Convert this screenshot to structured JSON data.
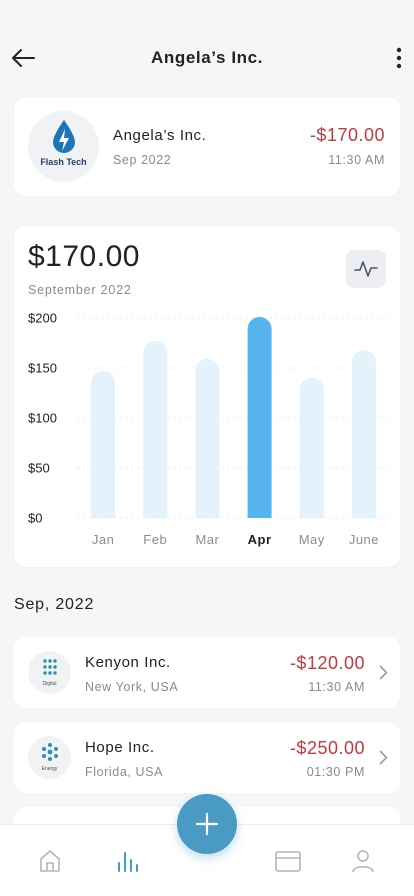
{
  "header": {
    "title": "Angela’s Inc."
  },
  "merchant": {
    "brand_text": "Flash Tech",
    "name": "Angela’s Inc.",
    "date": "Sep 2022",
    "amount": "-$170.00",
    "time": "11:30 AM"
  },
  "summary": {
    "total": "$170.00",
    "period": "September 2022"
  },
  "chart_data": {
    "type": "bar",
    "categories": [
      "Jan",
      "Feb",
      "Mar",
      "Apr",
      "May",
      "June"
    ],
    "values": [
      147,
      177,
      159,
      201,
      140,
      168
    ],
    "highlighted": "Apr",
    "yticks": [
      "$0",
      "$50",
      "$100",
      "$150",
      "$200"
    ],
    "ytick_values": [
      0,
      50,
      100,
      150,
      200
    ],
    "ylim": [
      0,
      200
    ],
    "grid": true,
    "colors": {
      "bar": "#e4f2fc",
      "active": "#56b4ef",
      "grid": "#ececf0"
    }
  },
  "section": {
    "title": "Sep, 2022"
  },
  "transactions": [
    {
      "icon": "digital-logo-icon",
      "caption": "Digital",
      "name": "Kenyon Inc.",
      "location": "New York, USA",
      "amount": "-$120.00",
      "time": "11:30 AM"
    },
    {
      "icon": "energy-logo-icon",
      "caption": "Energy",
      "name": "Hope Inc.",
      "location": "Florida, USA",
      "amount": "-$250.00",
      "time": "01:30 PM"
    }
  ],
  "tabs": [
    "home-icon",
    "stats-icon",
    "add-icon",
    "card-icon",
    "profile-icon"
  ],
  "theme": {
    "negative": "#c6383c",
    "accent": "#4a9bc4"
  }
}
